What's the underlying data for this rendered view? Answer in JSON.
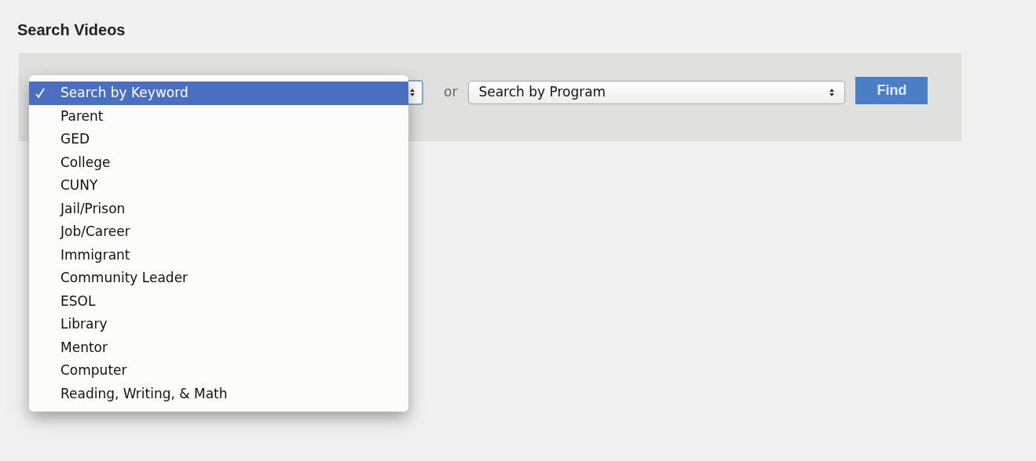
{
  "title": "Search Videos",
  "keyword_menu": {
    "items": [
      {
        "label": "Search by Keyword",
        "selected": true
      },
      {
        "label": "Parent",
        "selected": false
      },
      {
        "label": "GED",
        "selected": false
      },
      {
        "label": "College",
        "selected": false
      },
      {
        "label": "CUNY",
        "selected": false
      },
      {
        "label": "Jail/Prison",
        "selected": false
      },
      {
        "label": "Job/Career",
        "selected": false
      },
      {
        "label": "Immigrant",
        "selected": false
      },
      {
        "label": "Community Leader",
        "selected": false
      },
      {
        "label": "ESOL",
        "selected": false
      },
      {
        "label": "Library",
        "selected": false
      },
      {
        "label": "Mentor",
        "selected": false
      },
      {
        "label": "Computer",
        "selected": false
      },
      {
        "label": "Reading, Writing, & Math",
        "selected": false
      }
    ]
  },
  "or_label": "or",
  "program_select": {
    "value": "Search by Program"
  },
  "find_button": "Find"
}
